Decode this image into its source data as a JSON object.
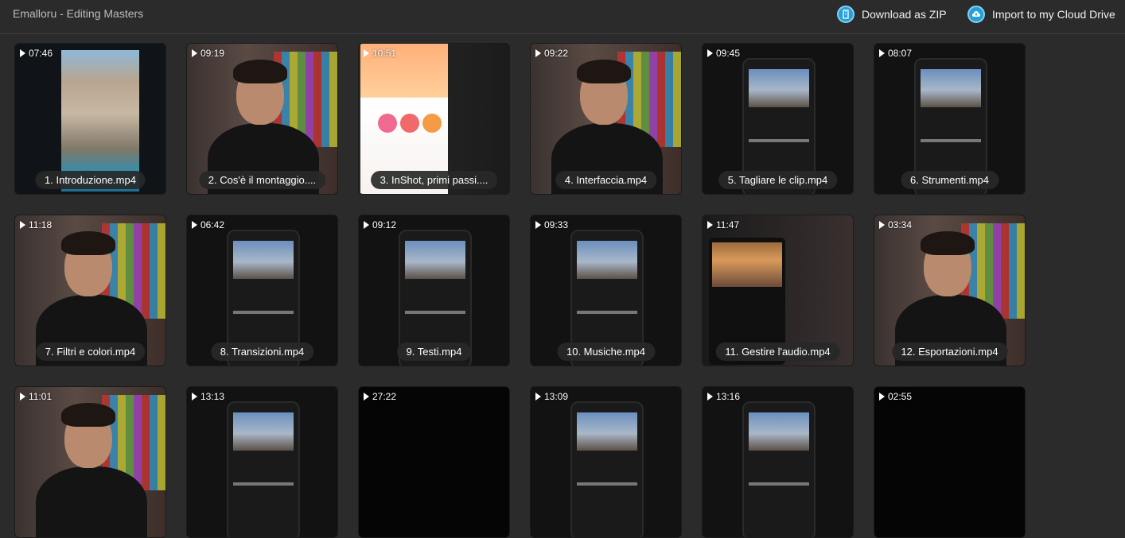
{
  "header": {
    "title": "Emalloru - Editing Masters",
    "actions": [
      {
        "label": "Download as ZIP",
        "icon": "zip-icon"
      },
      {
        "label": "Import to my Cloud Drive",
        "icon": "cloud-upload-icon"
      }
    ]
  },
  "colors": {
    "background": "#2b2b2b",
    "accent": "#2a9fd6",
    "pill": "#282828"
  },
  "videos": [
    {
      "duration": "07:46",
      "name": "1. Introduzione.mp4",
      "thumb": "cliff"
    },
    {
      "duration": "09:19",
      "name": "2. Cos'è il montaggio....",
      "thumb": "person"
    },
    {
      "duration": "10:51",
      "name": "3. InShot, primi passi....",
      "thumb": "app"
    },
    {
      "duration": "09:22",
      "name": "4. Interfaccia.mp4",
      "thumb": "person"
    },
    {
      "duration": "09:45",
      "name": "5. Tagliare le clip.mp4",
      "thumb": "phone"
    },
    {
      "duration": "08:07",
      "name": "6. Strumenti.mp4",
      "thumb": "phone"
    },
    {
      "duration": "11:18",
      "name": "7. Filtri e colori.mp4",
      "thumb": "person"
    },
    {
      "duration": "06:42",
      "name": "8. Transizioni.mp4",
      "thumb": "phone"
    },
    {
      "duration": "09:12",
      "name": "9. Testi.mp4",
      "thumb": "phone"
    },
    {
      "duration": "09:33",
      "name": "10. Musiche.mp4",
      "thumb": "phone"
    },
    {
      "duration": "11:47",
      "name": "11. Gestire l'audio.mp4",
      "thumb": "mixed"
    },
    {
      "duration": "03:34",
      "name": "12. Esportazioni.mp4",
      "thumb": "person"
    },
    {
      "duration": "11:01",
      "name": "",
      "thumb": "person"
    },
    {
      "duration": "13:13",
      "name": "",
      "thumb": "phone"
    },
    {
      "duration": "27:22",
      "name": "",
      "thumb": "black"
    },
    {
      "duration": "13:09",
      "name": "",
      "thumb": "phone"
    },
    {
      "duration": "13:16",
      "name": "",
      "thumb": "phone"
    },
    {
      "duration": "02:55",
      "name": "",
      "thumb": "black"
    }
  ]
}
